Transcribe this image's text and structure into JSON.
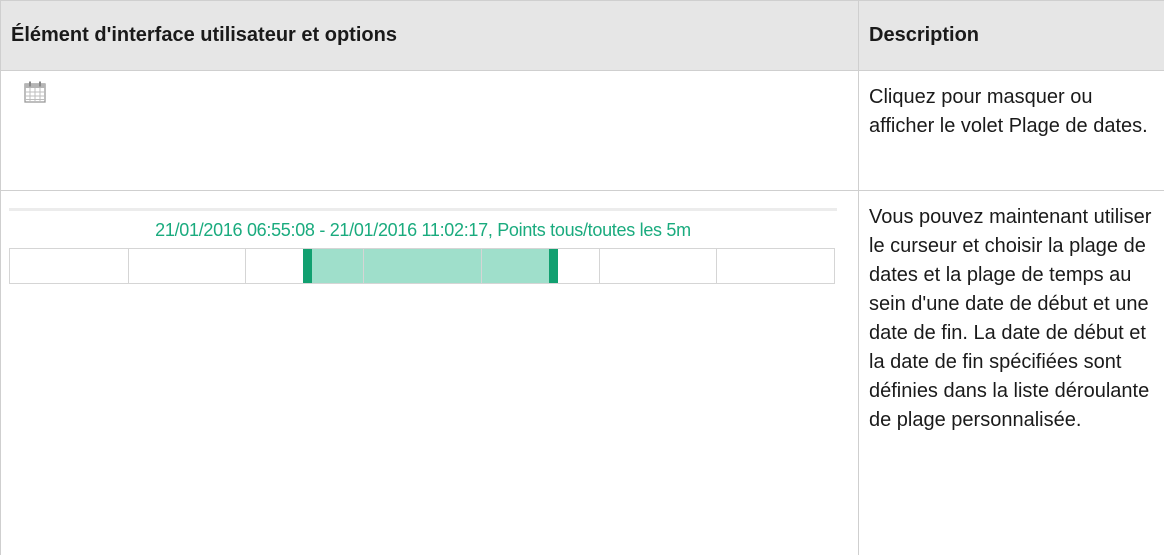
{
  "table": {
    "headers": {
      "element": "Élément d'interface utilisateur et options",
      "description": "Description"
    },
    "rows": [
      {
        "icon": "calendar-icon",
        "description": "Cliquez pour masquer ou afficher le volet Plage de dates."
      },
      {
        "slider": {
          "label": "21/01/2016 06:55:08 - 21/01/2016 11:02:17, Points tous/toutes les 5m",
          "range_start_fraction": 0.355,
          "range_end_fraction": 0.665,
          "segments": 7,
          "color_range": "#9fdfcb",
          "color_handle": "#11a070",
          "color_label": "#1aab7e"
        },
        "description": "Vous pouvez maintenant utiliser le curseur et choisir la plage de dates et la plage de temps au sein d'une date de début et une date de fin. La date de début et la date de fin spécifiées sont définies dans la liste déroulante de plage personnalisée."
      }
    ]
  }
}
